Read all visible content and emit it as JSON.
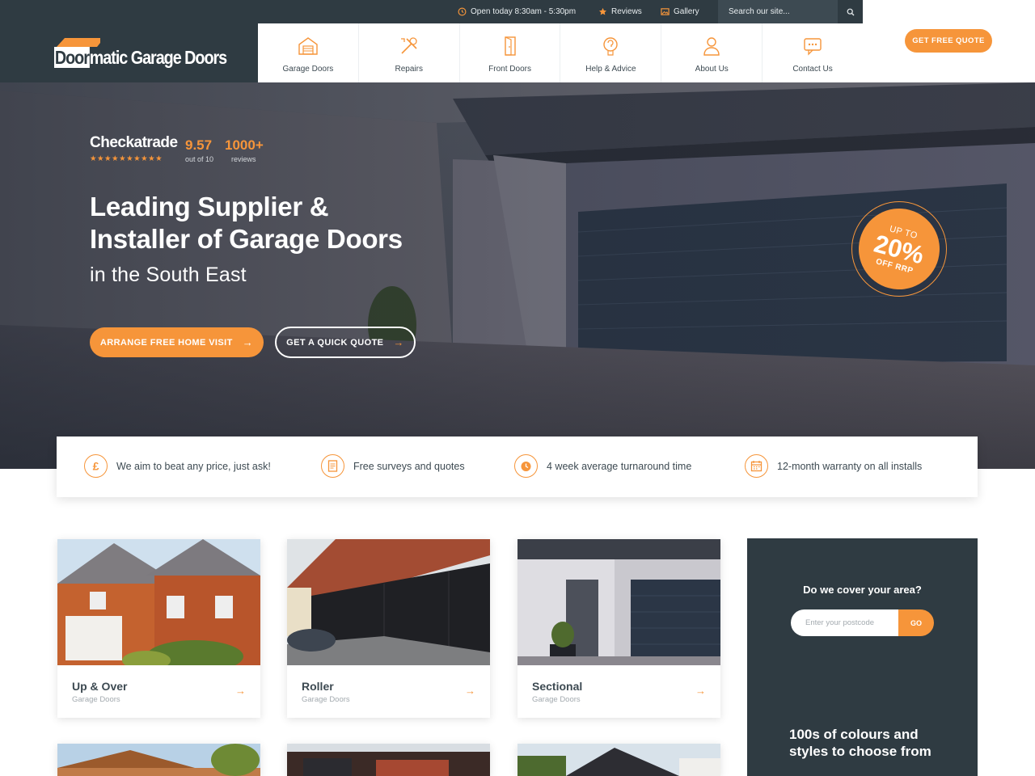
{
  "topbar": {
    "hours": "Open today 8:30am - 5:30pm",
    "reviews": "Reviews",
    "gallery": "Gallery",
    "search_placeholder": "Search our site..."
  },
  "header": {
    "logo_door": "Door",
    "logo_rest": "matic Garage Doors",
    "quote_button": "GET FREE QUOTE"
  },
  "nav": [
    {
      "label": "Garage Doors",
      "icon": "garage-icon"
    },
    {
      "label": "Repairs",
      "icon": "tools-icon"
    },
    {
      "label": "Front Doors",
      "icon": "door-icon"
    },
    {
      "label": "Help & Advice",
      "icon": "help-icon"
    },
    {
      "label": "About Us",
      "icon": "user-icon"
    },
    {
      "label": "Contact Us",
      "icon": "chat-icon"
    }
  ],
  "hero": {
    "checkatrade": "Checkatrade",
    "stars": "★★★★★★★★★★",
    "score": "9.57",
    "score_sub": "out of 10",
    "review_count": "1000+",
    "review_sub": "reviews",
    "title_line1": "Leading Supplier &",
    "title_line2": "Installer of Garage Doors",
    "subtitle": "in the South East",
    "primary_button": "ARRANGE FREE HOME VISIT",
    "secondary_button": "GET A QUICK QUOTE",
    "promo_top": "UP TO",
    "promo_value": "20%",
    "promo_bottom": "OFF RRP"
  },
  "usps": [
    {
      "text": "We aim to beat any price, just ask!",
      "icon": "pound-icon"
    },
    {
      "text": "Free surveys and quotes",
      "icon": "document-icon"
    },
    {
      "text": "4 week average turnaround time",
      "icon": "clock-icon"
    },
    {
      "text": "12-month warranty on all installs",
      "icon": "calendar-icon"
    }
  ],
  "products": [
    {
      "name": "Up & Over",
      "sub": "Garage Doors"
    },
    {
      "name": "Roller",
      "sub": "Garage Doors"
    },
    {
      "name": "Sectional",
      "sub": "Garage Doors"
    }
  ],
  "sidebar": {
    "title": "Do we cover your area?",
    "postcode_placeholder": "Enter your postcode",
    "go": "GO",
    "text": "100s of colours and styles to choose from"
  },
  "colors": {
    "accent": "#f6953a",
    "dark": "#2f3b42"
  }
}
